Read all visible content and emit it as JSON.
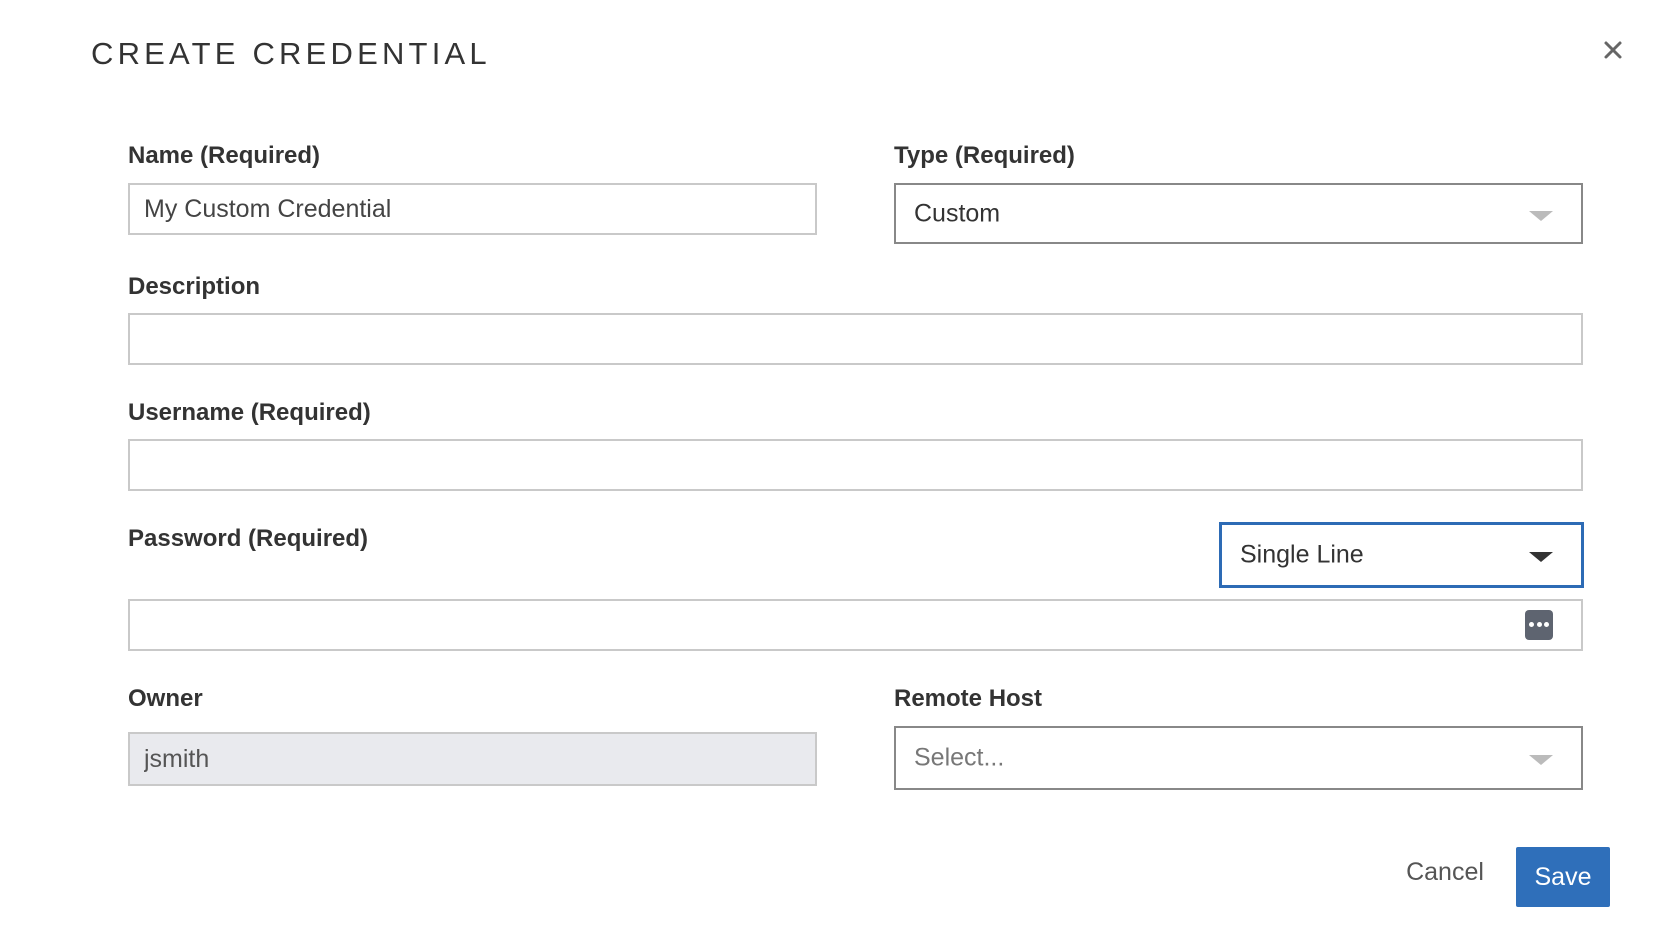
{
  "dialog": {
    "title": "CREATE CREDENTIAL",
    "close_icon": "close-icon"
  },
  "fields": {
    "name": {
      "label": "Name (Required)",
      "value": "My Custom Credential"
    },
    "type": {
      "label": "Type (Required)",
      "selected": "Custom"
    },
    "description": {
      "label": "Description",
      "value": ""
    },
    "username": {
      "label": "Username (Required)",
      "value": ""
    },
    "password": {
      "label": "Password (Required)",
      "value": "",
      "mode_selected": "Single Line",
      "reveal_icon": "more-dots-icon"
    },
    "owner": {
      "label": "Owner",
      "value": "jsmith"
    },
    "remote_host": {
      "label": "Remote Host",
      "placeholder": "Select..."
    }
  },
  "actions": {
    "cancel_label": "Cancel",
    "save_label": "Save"
  },
  "colors": {
    "accent": "#2f6fba",
    "focus_border": "#2d6bb5",
    "readonly_bg": "#e9eaee",
    "border": "#c9c9c9",
    "text": "#333333"
  }
}
